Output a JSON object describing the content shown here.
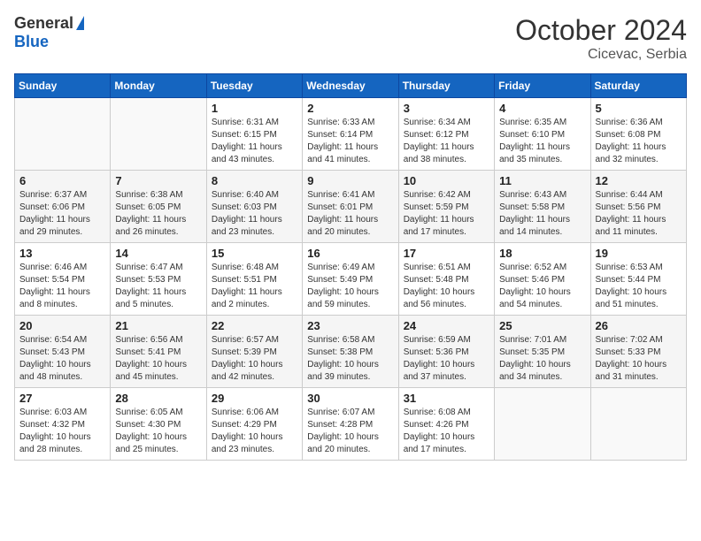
{
  "header": {
    "logo_general": "General",
    "logo_blue": "Blue",
    "title": "October 2024",
    "location": "Cicevac, Serbia"
  },
  "columns": [
    "Sunday",
    "Monday",
    "Tuesday",
    "Wednesday",
    "Thursday",
    "Friday",
    "Saturday"
  ],
  "weeks": [
    [
      {
        "day": "",
        "sunrise": "",
        "sunset": "",
        "daylight": ""
      },
      {
        "day": "",
        "sunrise": "",
        "sunset": "",
        "daylight": ""
      },
      {
        "day": "1",
        "sunrise": "Sunrise: 6:31 AM",
        "sunset": "Sunset: 6:15 PM",
        "daylight": "Daylight: 11 hours and 43 minutes."
      },
      {
        "day": "2",
        "sunrise": "Sunrise: 6:33 AM",
        "sunset": "Sunset: 6:14 PM",
        "daylight": "Daylight: 11 hours and 41 minutes."
      },
      {
        "day": "3",
        "sunrise": "Sunrise: 6:34 AM",
        "sunset": "Sunset: 6:12 PM",
        "daylight": "Daylight: 11 hours and 38 minutes."
      },
      {
        "day": "4",
        "sunrise": "Sunrise: 6:35 AM",
        "sunset": "Sunset: 6:10 PM",
        "daylight": "Daylight: 11 hours and 35 minutes."
      },
      {
        "day": "5",
        "sunrise": "Sunrise: 6:36 AM",
        "sunset": "Sunset: 6:08 PM",
        "daylight": "Daylight: 11 hours and 32 minutes."
      }
    ],
    [
      {
        "day": "6",
        "sunrise": "Sunrise: 6:37 AM",
        "sunset": "Sunset: 6:06 PM",
        "daylight": "Daylight: 11 hours and 29 minutes."
      },
      {
        "day": "7",
        "sunrise": "Sunrise: 6:38 AM",
        "sunset": "Sunset: 6:05 PM",
        "daylight": "Daylight: 11 hours and 26 minutes."
      },
      {
        "day": "8",
        "sunrise": "Sunrise: 6:40 AM",
        "sunset": "Sunset: 6:03 PM",
        "daylight": "Daylight: 11 hours and 23 minutes."
      },
      {
        "day": "9",
        "sunrise": "Sunrise: 6:41 AM",
        "sunset": "Sunset: 6:01 PM",
        "daylight": "Daylight: 11 hours and 20 minutes."
      },
      {
        "day": "10",
        "sunrise": "Sunrise: 6:42 AM",
        "sunset": "Sunset: 5:59 PM",
        "daylight": "Daylight: 11 hours and 17 minutes."
      },
      {
        "day": "11",
        "sunrise": "Sunrise: 6:43 AM",
        "sunset": "Sunset: 5:58 PM",
        "daylight": "Daylight: 11 hours and 14 minutes."
      },
      {
        "day": "12",
        "sunrise": "Sunrise: 6:44 AM",
        "sunset": "Sunset: 5:56 PM",
        "daylight": "Daylight: 11 hours and 11 minutes."
      }
    ],
    [
      {
        "day": "13",
        "sunrise": "Sunrise: 6:46 AM",
        "sunset": "Sunset: 5:54 PM",
        "daylight": "Daylight: 11 hours and 8 minutes."
      },
      {
        "day": "14",
        "sunrise": "Sunrise: 6:47 AM",
        "sunset": "Sunset: 5:53 PM",
        "daylight": "Daylight: 11 hours and 5 minutes."
      },
      {
        "day": "15",
        "sunrise": "Sunrise: 6:48 AM",
        "sunset": "Sunset: 5:51 PM",
        "daylight": "Daylight: 11 hours and 2 minutes."
      },
      {
        "day": "16",
        "sunrise": "Sunrise: 6:49 AM",
        "sunset": "Sunset: 5:49 PM",
        "daylight": "Daylight: 10 hours and 59 minutes."
      },
      {
        "day": "17",
        "sunrise": "Sunrise: 6:51 AM",
        "sunset": "Sunset: 5:48 PM",
        "daylight": "Daylight: 10 hours and 56 minutes."
      },
      {
        "day": "18",
        "sunrise": "Sunrise: 6:52 AM",
        "sunset": "Sunset: 5:46 PM",
        "daylight": "Daylight: 10 hours and 54 minutes."
      },
      {
        "day": "19",
        "sunrise": "Sunrise: 6:53 AM",
        "sunset": "Sunset: 5:44 PM",
        "daylight": "Daylight: 10 hours and 51 minutes."
      }
    ],
    [
      {
        "day": "20",
        "sunrise": "Sunrise: 6:54 AM",
        "sunset": "Sunset: 5:43 PM",
        "daylight": "Daylight: 10 hours and 48 minutes."
      },
      {
        "day": "21",
        "sunrise": "Sunrise: 6:56 AM",
        "sunset": "Sunset: 5:41 PM",
        "daylight": "Daylight: 10 hours and 45 minutes."
      },
      {
        "day": "22",
        "sunrise": "Sunrise: 6:57 AM",
        "sunset": "Sunset: 5:39 PM",
        "daylight": "Daylight: 10 hours and 42 minutes."
      },
      {
        "day": "23",
        "sunrise": "Sunrise: 6:58 AM",
        "sunset": "Sunset: 5:38 PM",
        "daylight": "Daylight: 10 hours and 39 minutes."
      },
      {
        "day": "24",
        "sunrise": "Sunrise: 6:59 AM",
        "sunset": "Sunset: 5:36 PM",
        "daylight": "Daylight: 10 hours and 37 minutes."
      },
      {
        "day": "25",
        "sunrise": "Sunrise: 7:01 AM",
        "sunset": "Sunset: 5:35 PM",
        "daylight": "Daylight: 10 hours and 34 minutes."
      },
      {
        "day": "26",
        "sunrise": "Sunrise: 7:02 AM",
        "sunset": "Sunset: 5:33 PM",
        "daylight": "Daylight: 10 hours and 31 minutes."
      }
    ],
    [
      {
        "day": "27",
        "sunrise": "Sunrise: 6:03 AM",
        "sunset": "Sunset: 4:32 PM",
        "daylight": "Daylight: 10 hours and 28 minutes."
      },
      {
        "day": "28",
        "sunrise": "Sunrise: 6:05 AM",
        "sunset": "Sunset: 4:30 PM",
        "daylight": "Daylight: 10 hours and 25 minutes."
      },
      {
        "day": "29",
        "sunrise": "Sunrise: 6:06 AM",
        "sunset": "Sunset: 4:29 PM",
        "daylight": "Daylight: 10 hours and 23 minutes."
      },
      {
        "day": "30",
        "sunrise": "Sunrise: 6:07 AM",
        "sunset": "Sunset: 4:28 PM",
        "daylight": "Daylight: 10 hours and 20 minutes."
      },
      {
        "day": "31",
        "sunrise": "Sunrise: 6:08 AM",
        "sunset": "Sunset: 4:26 PM",
        "daylight": "Daylight: 10 hours and 17 minutes."
      },
      {
        "day": "",
        "sunrise": "",
        "sunset": "",
        "daylight": ""
      },
      {
        "day": "",
        "sunrise": "",
        "sunset": "",
        "daylight": ""
      }
    ]
  ]
}
